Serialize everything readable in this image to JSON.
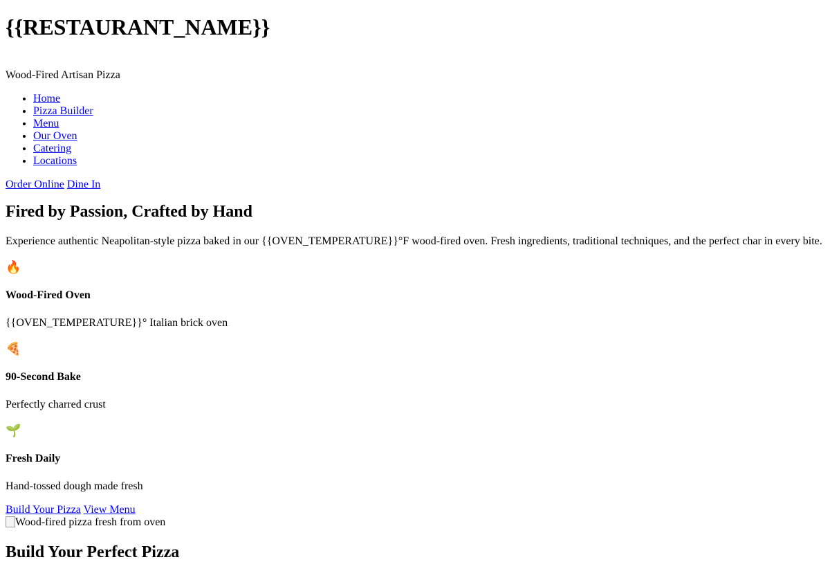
{
  "header": {
    "restaurant_name": "{{RESTAURANT_NAME}}",
    "tagline": "Wood-Fired Artisan Pizza"
  },
  "nav": {
    "items": [
      {
        "label": "Home"
      },
      {
        "label": "Pizza Builder"
      },
      {
        "label": "Menu"
      },
      {
        "label": "Our Oven"
      },
      {
        "label": "Catering"
      },
      {
        "label": "Locations"
      }
    ]
  },
  "header_actions": {
    "order_online": "Order Online",
    "dine_in": "Dine In"
  },
  "hero": {
    "title": "Fired by Passion, Crafted by Hand",
    "description": "Experience authentic Neapolitan-style pizza baked in our {{OVEN_TEMPERATURE}}°F wood-fired oven. Fresh ingredients, traditional techniques, and the perfect char in every bite.",
    "features": [
      {
        "icon": "🔥",
        "icon_name": "fire-icon",
        "title": "Wood-Fired Oven",
        "text": "{{OVEN_TEMPERATURE}}° Italian brick oven"
      },
      {
        "icon": "🍕",
        "icon_name": "pizza-icon",
        "title": "90-Second Bake",
        "text": "Perfectly charred crust"
      },
      {
        "icon": "🌱",
        "icon_name": "seedling-icon",
        "title": "Fresh Daily",
        "text": "Hand-tossed dough made fresh"
      }
    ],
    "cta_build": "Build Your Pizza",
    "cta_menu": "View Menu",
    "image_alt": "Wood-fired pizza fresh from oven"
  },
  "builder": {
    "title": "Build Your Perfect Pizza"
  },
  "colors": {
    "link": "#0000ee",
    "text": "#000000",
    "background": "#ffffff"
  }
}
